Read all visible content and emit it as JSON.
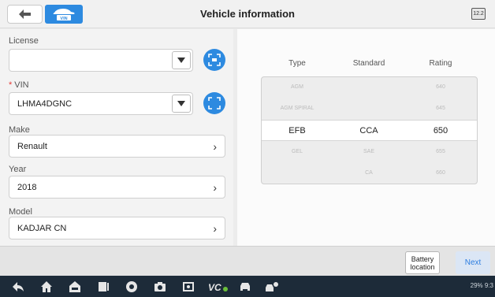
{
  "header": {
    "title": "Vehicle information",
    "vin_button_text": "VIN",
    "battery_icon_text": "12.2"
  },
  "form": {
    "license": {
      "label": "License",
      "value": ""
    },
    "vin": {
      "label": "VIN",
      "required_marker": "*",
      "value": "LHMA4DGNC"
    },
    "make": {
      "label": "Make",
      "value": "Renault"
    },
    "year": {
      "label": "Year",
      "value": "2018"
    },
    "model": {
      "label": "Model",
      "value": "KADJAR CN"
    }
  },
  "table": {
    "headers": [
      "Type",
      "Standard",
      "Rating"
    ],
    "rows": [
      {
        "type": "AGM",
        "standard": "",
        "rating": "640"
      },
      {
        "type": "AGM SPIRAL",
        "standard": "",
        "rating": "645"
      },
      {
        "type": "EFB",
        "standard": "CCA",
        "rating": "650"
      },
      {
        "type": "GEL",
        "standard": "SAE",
        "rating": "655"
      },
      {
        "type": "",
        "standard": "CA",
        "rating": "660"
      }
    ],
    "selected_row": 2
  },
  "bottom": {
    "battery_location_label": "Battery location",
    "next_label": "Next"
  },
  "taskbar": {
    "status_text": "29%",
    "time_text": "9:3"
  },
  "colors": {
    "accent": "#2d8ae0",
    "taskbar": "#1d2b39",
    "required": "#e53935"
  }
}
